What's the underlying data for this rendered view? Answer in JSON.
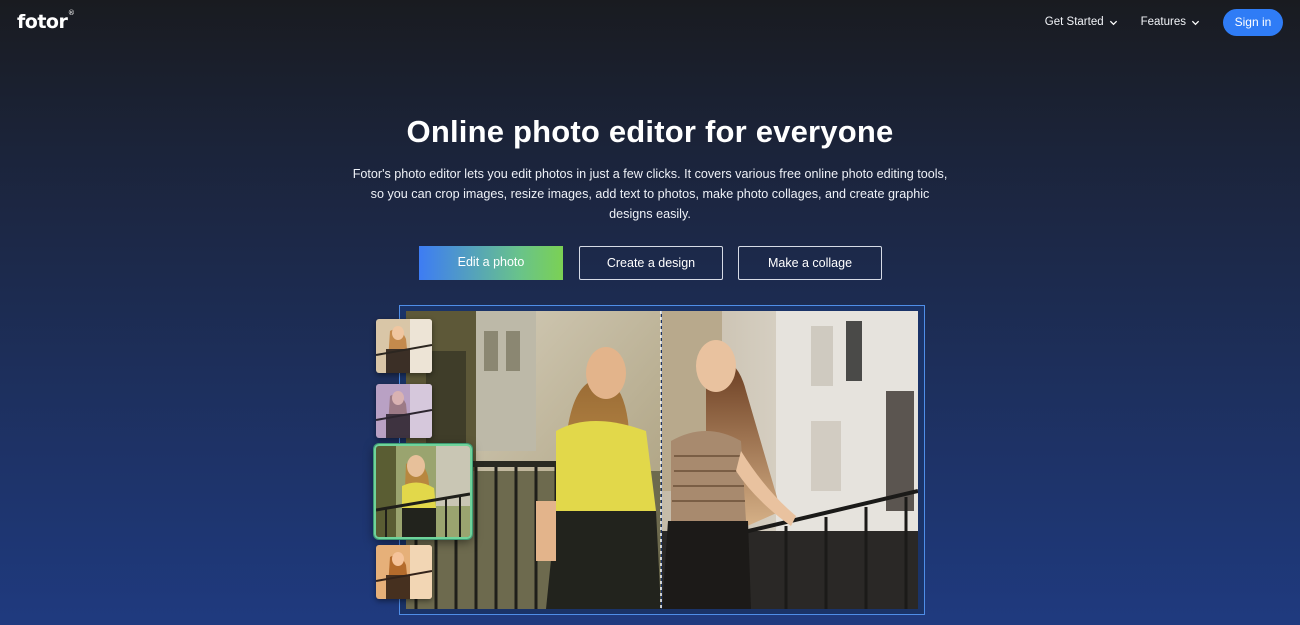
{
  "header": {
    "logo_text": "fotor",
    "logo_mark": "®",
    "nav": [
      {
        "label": "Get Started",
        "icon": "chevron-down-icon"
      },
      {
        "label": "Features",
        "icon": "chevron-down-icon"
      }
    ],
    "signin_label": "Sign in",
    "signin_color": "#2f7cf6"
  },
  "hero": {
    "title": "Online photo editor for everyone",
    "description": "Fotor's photo editor lets you edit photos in just a few clicks. It covers various free online photo editing tools, so you can crop images, resize images, add text to photos, make photo collages, and create graphic designs easily.",
    "buttons": {
      "edit_photo": "Edit a photo",
      "create_design": "Create a design",
      "make_collage": "Make a collage"
    }
  },
  "showcase": {
    "thumbnails": [
      "warm-filter",
      "purple-filter",
      "green-filter",
      "orange-filter"
    ],
    "active_thumbnail": "green-filter",
    "frame_color": "#4f8ee8"
  }
}
